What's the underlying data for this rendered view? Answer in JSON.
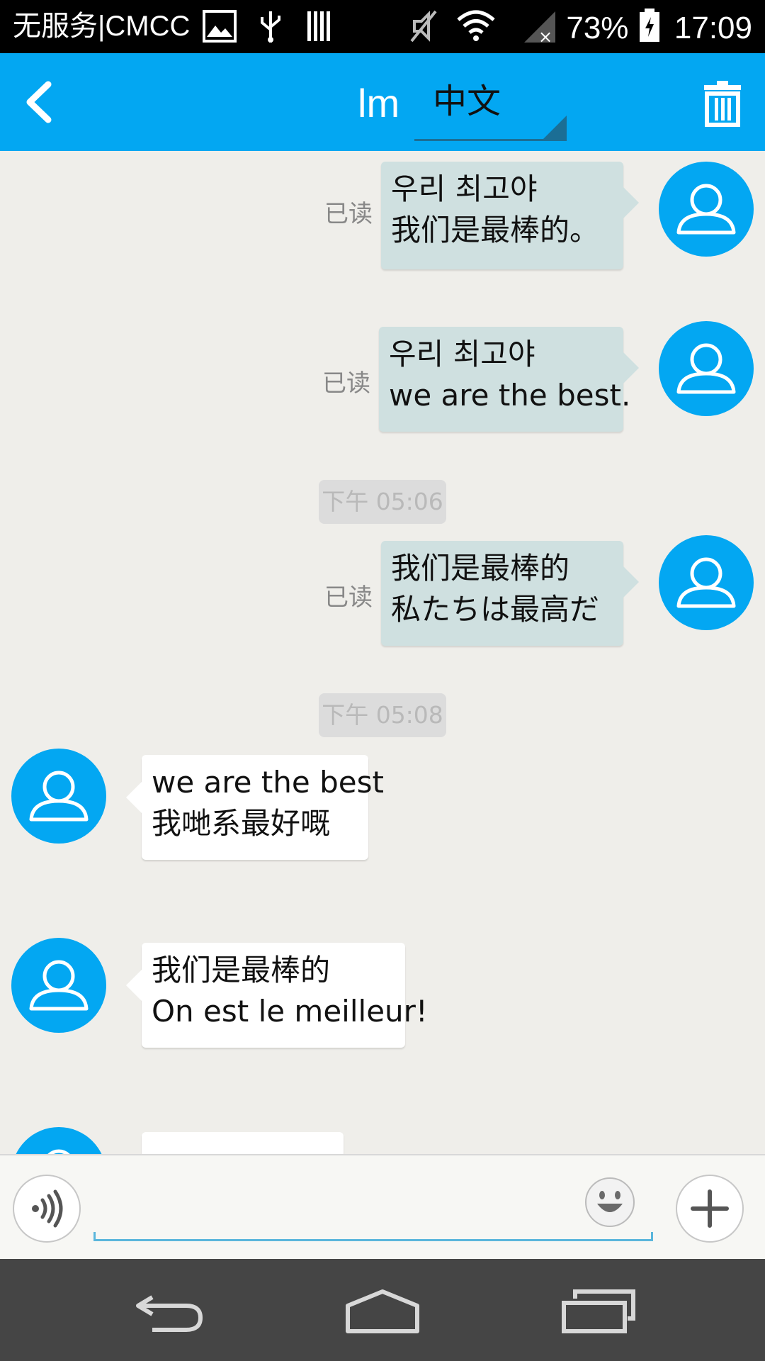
{
  "status_bar": {
    "carrier": "无服务|CMCC",
    "battery": "73%",
    "time": "17:09"
  },
  "toolbar": {
    "title": "lm",
    "language": "中文",
    "icons": [
      "back-arrow-icon",
      "trash-icon"
    ]
  },
  "messages": [
    {
      "direction": "out",
      "read_label": "已读",
      "lines": [
        "우리 최고야",
        "我们是最棒的。"
      ]
    },
    {
      "direction": "out",
      "read_label": "已读",
      "lines": [
        "우리 최고야",
        "we are the best."
      ]
    },
    {
      "direction": "out",
      "read_label": "已读",
      "lines": [
        "我们是最棒的",
        "私たちは最高だ"
      ]
    },
    {
      "direction": "in",
      "lines": [
        "we are the best",
        "我哋系最好嘅"
      ]
    },
    {
      "direction": "in",
      "lines": [
        "我们是最棒的",
        "On est le meilleur!"
      ]
    }
  ],
  "timestamps": [
    "下午 05:06",
    "下午 05:08"
  ],
  "input_bar": {
    "text": "",
    "icons": [
      "voice-icon",
      "emoji-icon",
      "plus-icon"
    ]
  },
  "nav_bar": {
    "icons": [
      "back-icon",
      "home-icon",
      "recents-icon"
    ]
  },
  "colors": {
    "accent": "#03a7f2",
    "outgoing_bubble": "#cfe0e0",
    "incoming_bubble": "#ffffff",
    "background": "#efeeea"
  }
}
